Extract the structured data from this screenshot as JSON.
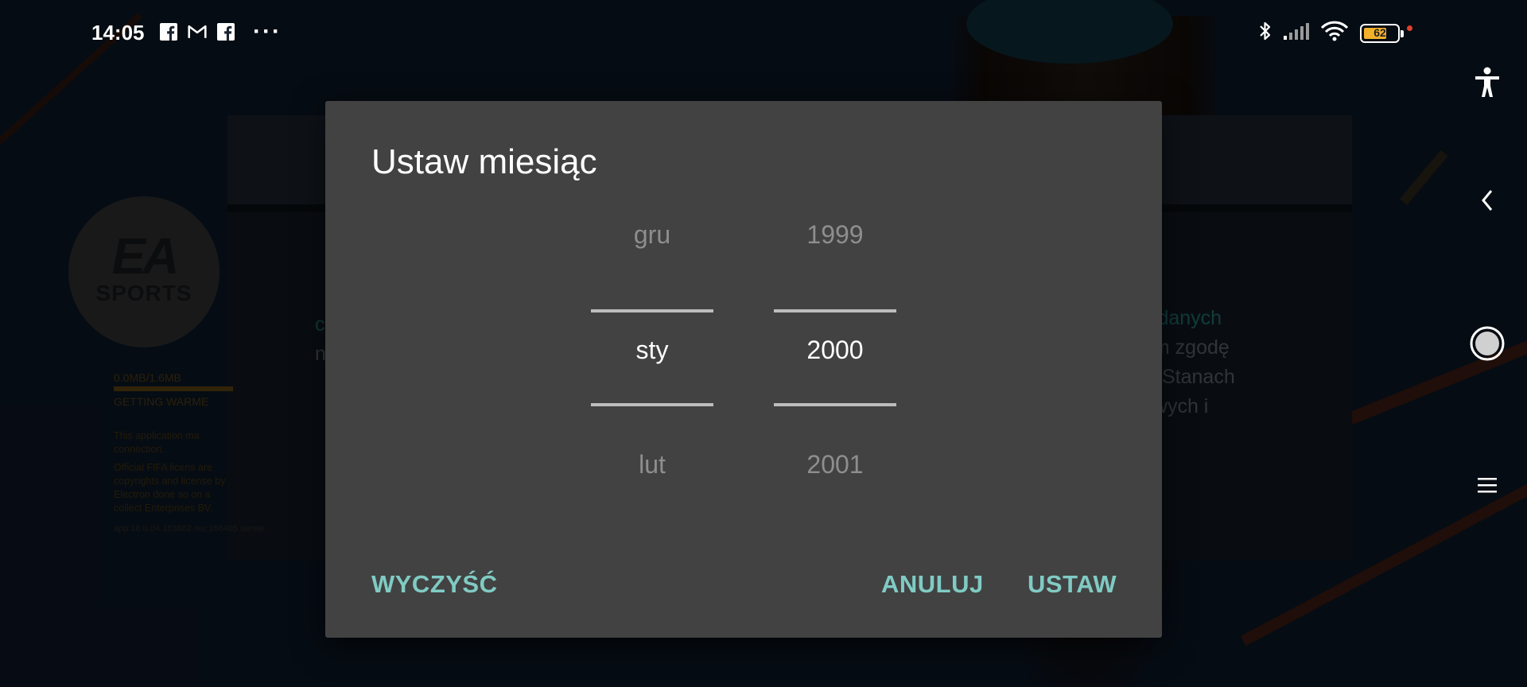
{
  "status_bar": {
    "time": "14:05",
    "notifications": [
      "facebook-icon",
      "gmail-icon",
      "facebook-icon"
    ],
    "more": "···",
    "battery_percent": "62"
  },
  "background": {
    "logo": {
      "ea": "EA",
      "sports": "SPORTS"
    },
    "loader": {
      "progress": "0.0MB/1.6MB",
      "status": "GETTING WARME",
      "notice1": "This application ma connection.",
      "notice2": "Official FIFA licens are copyrights and license by Electron done so on a collect Enterprises BV.",
      "build": "app:18.0.04.183882 res:166405 server"
    },
    "left_fragment": {
      "line1": "c",
      "line2": "n"
    },
    "right_text": {
      "accent": "y danych",
      "body": "am zgodę\nw Stanach\nowych i"
    }
  },
  "dialog": {
    "title": "Ustaw miesiąc",
    "month": {
      "prev": "gru",
      "selected": "sty",
      "next": "lut"
    },
    "year": {
      "prev": "1999",
      "selected": "2000",
      "next": "2001"
    },
    "buttons": {
      "clear": "WYCZYŚĆ",
      "cancel": "ANULUJ",
      "set": "USTAW"
    }
  },
  "colors": {
    "dialog_bg": "#424242",
    "accent": "#80cbc4",
    "battery": "#f3b12b"
  }
}
